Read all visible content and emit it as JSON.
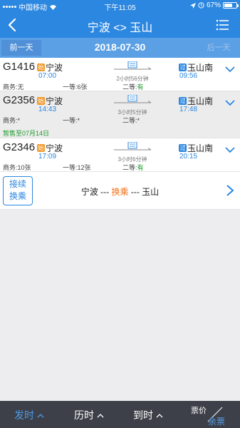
{
  "status_bar": {
    "carrier": "中国移动",
    "time": "下午11:05",
    "battery": "67%",
    "battery_level": 0.67
  },
  "header": {
    "title": "宁波 <> 玉山",
    "back_icon": "chevron-left-icon",
    "menu_icon": "list-menu-icon"
  },
  "date_nav": {
    "prev_label": "前一天",
    "date": "2018-07-30",
    "next_label": "后一天"
  },
  "trains": [
    {
      "number": "G1416",
      "from_badge": "始",
      "from": "宁波",
      "dep_time": "07:00",
      "duration": "2小时56分钟",
      "to_badge": "过",
      "to": "玉山南",
      "arr_time": "09:56",
      "seats": {
        "business_label": "商务:",
        "business_value": "无",
        "first_label": "一等:",
        "first_value": "6张",
        "second_label": "二等:",
        "second_value": "有"
      },
      "notice": ""
    },
    {
      "number": "G2356",
      "from_badge": "始",
      "from": "宁波",
      "dep_time": "14:43",
      "duration": "3小时5分钟",
      "to_badge": "过",
      "to": "玉山南",
      "arr_time": "17:48",
      "seats": {
        "business_label": "商务:",
        "business_value": "*",
        "first_label": "一等:",
        "first_value": "*",
        "second_label": "二等:",
        "second_value": "*"
      },
      "notice": "暂售至07月14日"
    },
    {
      "number": "G2346",
      "from_badge": "始",
      "from": "宁波",
      "dep_time": "17:09",
      "duration": "3小时6分钟",
      "to_badge": "过",
      "to": "玉山南",
      "arr_time": "20:15",
      "seats": {
        "business_label": "商务:",
        "business_value": "10张",
        "first_label": "一等:",
        "first_value": "12张",
        "second_label": "二等:",
        "second_value": "有"
      },
      "notice": ""
    }
  ],
  "transfer": {
    "button_line1": "接续",
    "button_line2": "换乘",
    "route_from": "宁波",
    "route_sep1": " --- ",
    "route_mid": "换乘",
    "route_sep2": " --- ",
    "route_to": "玉山"
  },
  "bottom_bar": {
    "tabs": [
      {
        "label": "发时"
      },
      {
        "label": "历时"
      },
      {
        "label": "到时"
      }
    ],
    "fare_label": "票价",
    "remaining_label": "余票"
  },
  "colors": {
    "accent": "#2c87e0",
    "available": "#1a9b2a",
    "transfer_highlight": "#f2711c",
    "bottom_bar": "#3d4048"
  }
}
